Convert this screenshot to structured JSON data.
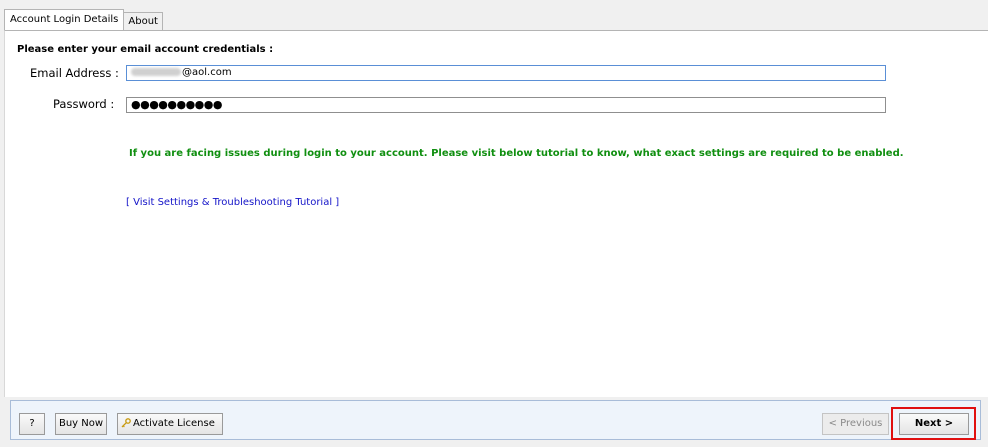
{
  "tabs": [
    {
      "label": "Account Login Details"
    },
    {
      "label": "About"
    }
  ],
  "form": {
    "heading": "Please enter your email account credentials :",
    "email_label": "Email Address :",
    "email_value_suffix": "@aol.com",
    "password_label": "Password :",
    "password_value": "●●●●●●●●●●"
  },
  "notice": "If you are facing issues during login to your account. Please visit below tutorial to know, what exact settings are required to be enabled.",
  "tutorial_link": "[ Visit Settings & Troubleshooting Tutorial ]",
  "footer": {
    "help_label": "?",
    "buy_label": "Buy Now",
    "activate_label": "Activate License",
    "activate_icon": "key-icon",
    "previous_label": "< Previous",
    "next_label": "Next >"
  },
  "colors": {
    "notice": "#108f10",
    "link": "#1414c8",
    "highlight": "#e01010"
  }
}
